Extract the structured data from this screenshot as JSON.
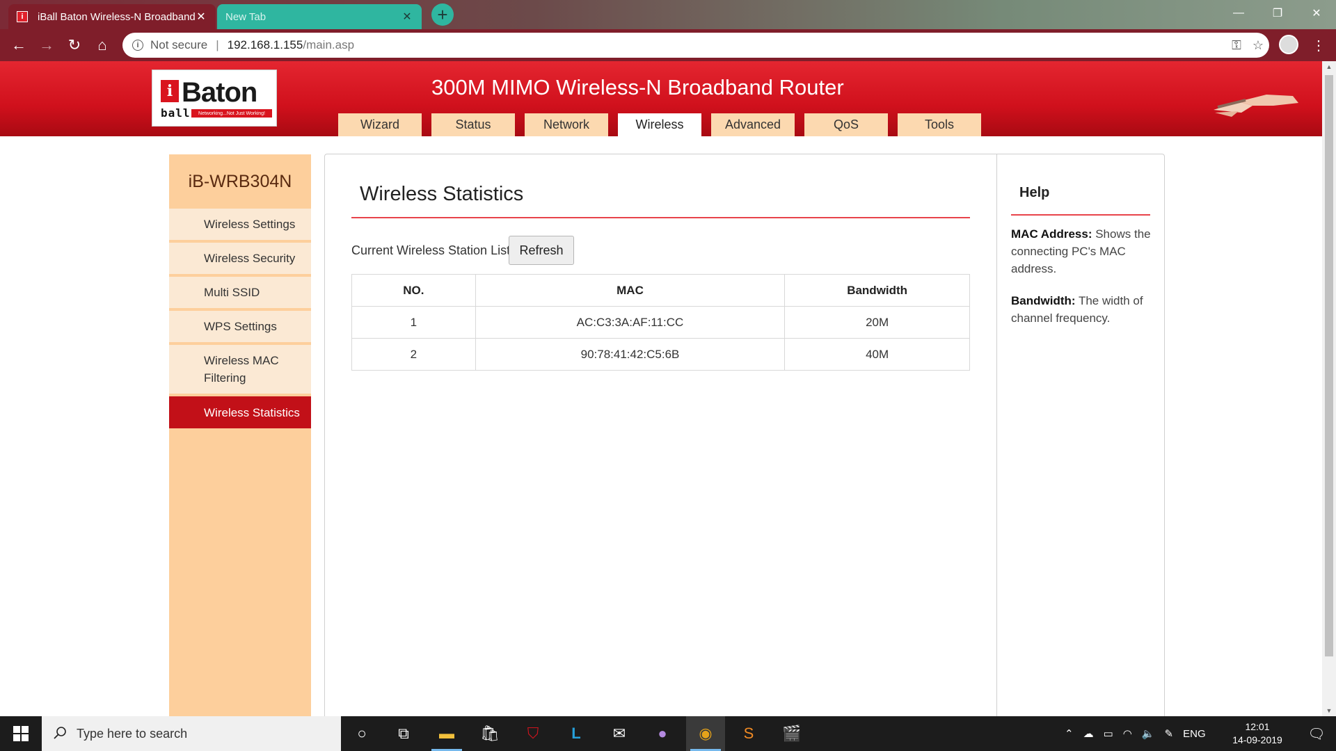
{
  "browser": {
    "tabs": [
      {
        "title": "iBall Baton Wireless-N Broadband",
        "favicon": "i"
      },
      {
        "title": "New Tab"
      }
    ],
    "address": {
      "security_label": "Not secure",
      "host": "192.168.1.155",
      "path": "/main.asp"
    }
  },
  "router": {
    "logo": {
      "brand": "Baton",
      "mark": "i",
      "sub": "ball",
      "tagline": "Networking...Not Just Working!"
    },
    "title": "300M MIMO Wireless-N Broadband Router",
    "nav": [
      "Wizard",
      "Status",
      "Network",
      "Wireless",
      "Advanced",
      "QoS",
      "Tools"
    ],
    "active_nav": "Wireless"
  },
  "sidebar": {
    "model": "iB-WRB304N",
    "items": [
      {
        "label": "Wireless Settings"
      },
      {
        "label": "Wireless Security"
      },
      {
        "label": "Multi SSID"
      },
      {
        "label": "WPS Settings"
      },
      {
        "label": "Wireless MAC Filtering"
      },
      {
        "label": "Wireless Statistics"
      }
    ],
    "active_item": "Wireless Statistics"
  },
  "main": {
    "title": "Wireless Statistics",
    "station_list_label": "Current Wireless Station List:",
    "refresh_label": "Refresh",
    "table": {
      "headers": [
        "NO.",
        "MAC",
        "Bandwidth"
      ],
      "rows": [
        [
          "1",
          "AC:C3:3A:AF:11:CC",
          "20M"
        ],
        [
          "2",
          "90:78:41:42:C5:6B",
          "40M"
        ]
      ]
    }
  },
  "help": {
    "title": "Help",
    "items": [
      {
        "term": "MAC Address:",
        "text": " Shows the connecting PC's MAC address."
      },
      {
        "term": "Bandwidth:",
        "text": " The width of channel frequency."
      }
    ]
  },
  "taskbar": {
    "search_placeholder": "Type here to search",
    "language": "ENG",
    "time": "12:01",
    "date": "14-09-2019"
  },
  "colors": {
    "header_red": "#d0101c",
    "tab_peach": "#fcd9b0",
    "sidebar_orange": "#fdcf9c",
    "active_item_red": "#c21018",
    "rule_red": "#e8434a"
  }
}
